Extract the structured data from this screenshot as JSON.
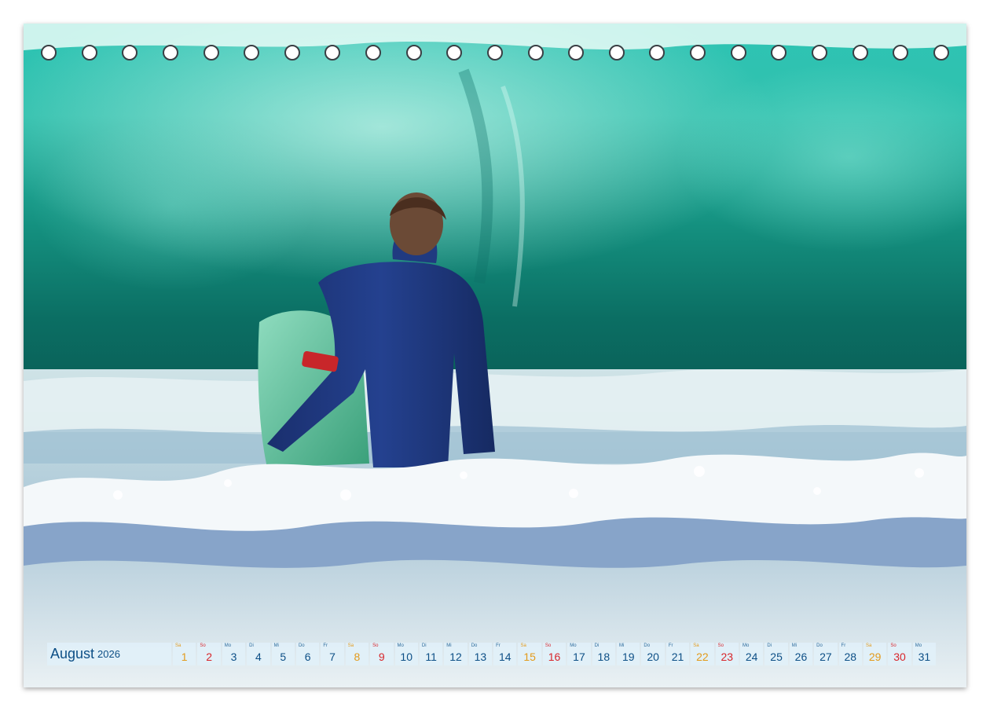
{
  "calendar": {
    "month": "August",
    "year": "2026",
    "days": [
      {
        "num": "1",
        "wd": "Sa",
        "type": "sat"
      },
      {
        "num": "2",
        "wd": "So",
        "type": "sun"
      },
      {
        "num": "3",
        "wd": "Mo",
        "type": "weekday"
      },
      {
        "num": "4",
        "wd": "Di",
        "type": "weekday"
      },
      {
        "num": "5",
        "wd": "Mi",
        "type": "weekday"
      },
      {
        "num": "6",
        "wd": "Do",
        "type": "weekday"
      },
      {
        "num": "7",
        "wd": "Fr",
        "type": "weekday"
      },
      {
        "num": "8",
        "wd": "Sa",
        "type": "sat"
      },
      {
        "num": "9",
        "wd": "So",
        "type": "sun"
      },
      {
        "num": "10",
        "wd": "Mo",
        "type": "weekday"
      },
      {
        "num": "11",
        "wd": "Di",
        "type": "weekday"
      },
      {
        "num": "12",
        "wd": "Mi",
        "type": "weekday"
      },
      {
        "num": "13",
        "wd": "Do",
        "type": "weekday"
      },
      {
        "num": "14",
        "wd": "Fr",
        "type": "weekday"
      },
      {
        "num": "15",
        "wd": "Sa",
        "type": "sat"
      },
      {
        "num": "16",
        "wd": "So",
        "type": "sun"
      },
      {
        "num": "17",
        "wd": "Mo",
        "type": "weekday"
      },
      {
        "num": "18",
        "wd": "Di",
        "type": "weekday"
      },
      {
        "num": "19",
        "wd": "Mi",
        "type": "weekday"
      },
      {
        "num": "20",
        "wd": "Do",
        "type": "weekday"
      },
      {
        "num": "21",
        "wd": "Fr",
        "type": "weekday"
      },
      {
        "num": "22",
        "wd": "Sa",
        "type": "sat"
      },
      {
        "num": "23",
        "wd": "So",
        "type": "sun"
      },
      {
        "num": "24",
        "wd": "Mo",
        "type": "weekday"
      },
      {
        "num": "25",
        "wd": "Di",
        "type": "weekday"
      },
      {
        "num": "26",
        "wd": "Mi",
        "type": "weekday"
      },
      {
        "num": "27",
        "wd": "Do",
        "type": "weekday"
      },
      {
        "num": "28",
        "wd": "Fr",
        "type": "weekday"
      },
      {
        "num": "29",
        "wd": "Sa",
        "type": "sat"
      },
      {
        "num": "30",
        "wd": "So",
        "type": "sun"
      },
      {
        "num": "31",
        "wd": "Mo",
        "type": "weekday"
      }
    ]
  },
  "colors": {
    "month_text": "#0d4f86",
    "saturday": "#e39a1a",
    "sunday": "#d8262b",
    "strip_bg": "#e1f0f8",
    "wave_teal": "#1fb8a6"
  }
}
